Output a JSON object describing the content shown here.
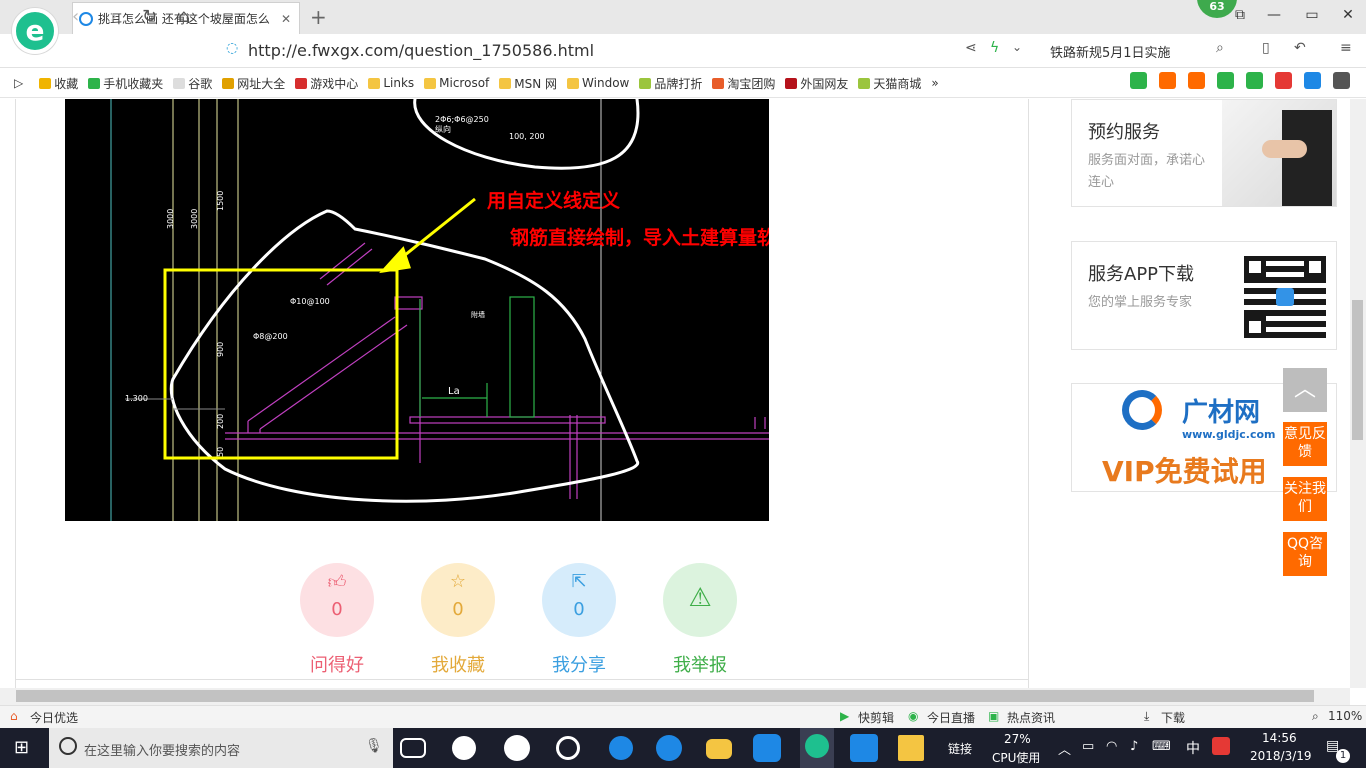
{
  "browser": {
    "tab_title": "挑耳怎么画 还有这个坡屋面怎么",
    "badge_count": "63",
    "url_prefix": "http://e.",
    "url_domain": "fwxgx.com",
    "url_path": "/question_1750586.html",
    "news_ticker": "铁路新规5月1日实施"
  },
  "bookmarks": [
    "收藏",
    "手机收藏夹",
    "谷歌",
    "网址大全",
    "游戏中心",
    "Links",
    "Microsof",
    "MSN 网",
    "Window",
    "品牌打折",
    "淘宝团购",
    "外国网友",
    "天猫商城"
  ],
  "cad": {
    "annotation_line1": "用自定义线定义",
    "annotation_line2": "钢筋直接绘制，导入土建算量软件可以构件转换",
    "labels": {
      "rebar_top": "2Φ6;Φ6@250",
      "rebar_top2": "纵向",
      "dim_top": "100, 200",
      "d3000a": "3000",
      "d3000b": "3000",
      "d1500": "1500",
      "rebar1": "Φ10@100",
      "rebar2": "Φ8@200",
      "d900": "900",
      "d200": "200",
      "d50": "50",
      "elev": "1.300",
      "la": "La",
      "wall": "附墙"
    }
  },
  "actions": [
    {
      "label": "问得好",
      "count": "0",
      "icon": "thumbs-up"
    },
    {
      "label": "我收藏",
      "count": "0",
      "icon": "star"
    },
    {
      "label": "我分享",
      "count": "0",
      "icon": "share"
    },
    {
      "label": "我举报",
      "count": "",
      "icon": "warning"
    }
  ],
  "sidebar": {
    "service_title": "预约服务",
    "service_desc": "服务面对面，承诺心连心",
    "app_title": "服务APP下载",
    "app_desc": "您的掌上服务专家",
    "ad_brand": "广材网",
    "ad_url": "www.gldjc.com",
    "ad_vip": "VIP免费试用",
    "float_feedback": "意见反馈",
    "float_follow": "关注我们",
    "float_qq": "QQ咨询"
  },
  "statusbar": {
    "left": "今日优选",
    "items": [
      "快剪辑",
      "今日直播",
      "热点资讯",
      "下载"
    ],
    "zoom": "110%"
  },
  "taskbar": {
    "search_placeholder": "在这里输入你要搜索的内容",
    "links": "链接",
    "cpu_percent": "27%",
    "cpu_label": "CPU使用",
    "ime": "中",
    "time": "14:56",
    "date": "2018/3/19",
    "notifications": "1"
  },
  "colors": {
    "accent": "#1ec08f",
    "orange": "#ff6a00",
    "cad_yellow": "#ffff00",
    "cad_red": "#ff0000"
  }
}
